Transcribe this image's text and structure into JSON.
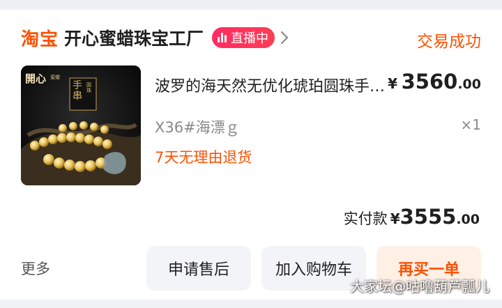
{
  "shop": {
    "platform_logo": "淘宝",
    "name": "开心蜜蜡珠宝工厂",
    "live_label": "直播中",
    "live_icon": "live-bars-icon",
    "chevron_icon": "chevron-right-icon",
    "order_status": "交易成功"
  },
  "item": {
    "thumb_logo_text": "開心",
    "thumb_logo_sub": "蜜蠟",
    "thumb_card_text": "手串",
    "thumb_card_side": "圓珠",
    "title": "波罗的海天然无优化琥珀圆珠手串蜜蜡",
    "price_currency": "¥",
    "price_main": "3560",
    "price_decimal": ".00",
    "sku": "X36#海漂ｇ",
    "quantity": "×1",
    "service_promise": "7天无理由退货"
  },
  "payment": {
    "label": "实付款",
    "currency": "¥",
    "amount_main": "3555",
    "amount_decimal": ".00"
  },
  "actions": {
    "more": "更多",
    "after_sales": "申请售后",
    "add_to_cart": "加入购物车",
    "buy_again": "再买一单"
  },
  "watermark": "大家坛@咕噜葫芦瓢儿",
  "colors": {
    "accent": "#ff5000",
    "live_badge": "#ff2c62",
    "button_bg": "#f3f4f7",
    "primary_button_bg": "#fff0e6"
  }
}
